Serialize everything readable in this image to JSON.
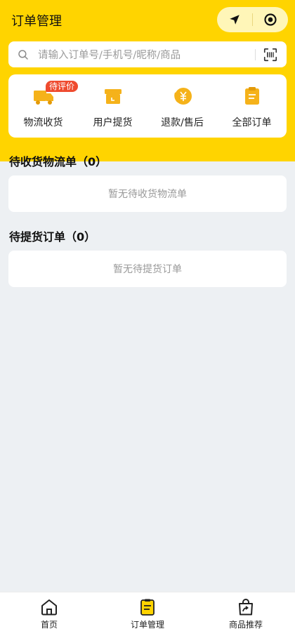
{
  "header": {
    "title": "订单管理",
    "accent_color": "#ffd400"
  },
  "search": {
    "placeholder": "请输入订单号/手机号/昵称/商品",
    "icon": "search-icon",
    "scan_icon": "scan-icon"
  },
  "quick_actions": {
    "items": [
      {
        "label": "物流收货",
        "icon": "truck-icon",
        "badge": "待评价"
      },
      {
        "label": "用户提货",
        "icon": "pickup-box-icon"
      },
      {
        "label": "退款/售后",
        "icon": "refund-yen-icon"
      },
      {
        "label": "全部订单",
        "icon": "clipboard-icon"
      }
    ]
  },
  "sections": {
    "logistics": {
      "title": "待收货物流单（0）",
      "empty": "暂无待收货物流单"
    },
    "pickup": {
      "title": "待提货订单（0）",
      "empty": "暂无待提货订单"
    }
  },
  "tabbar": {
    "items": [
      {
        "label": "首页",
        "icon": "home-icon"
      },
      {
        "label": "订单管理",
        "icon": "order-icon",
        "active": true
      },
      {
        "label": "商品推荐",
        "icon": "share-bag-icon"
      }
    ]
  }
}
